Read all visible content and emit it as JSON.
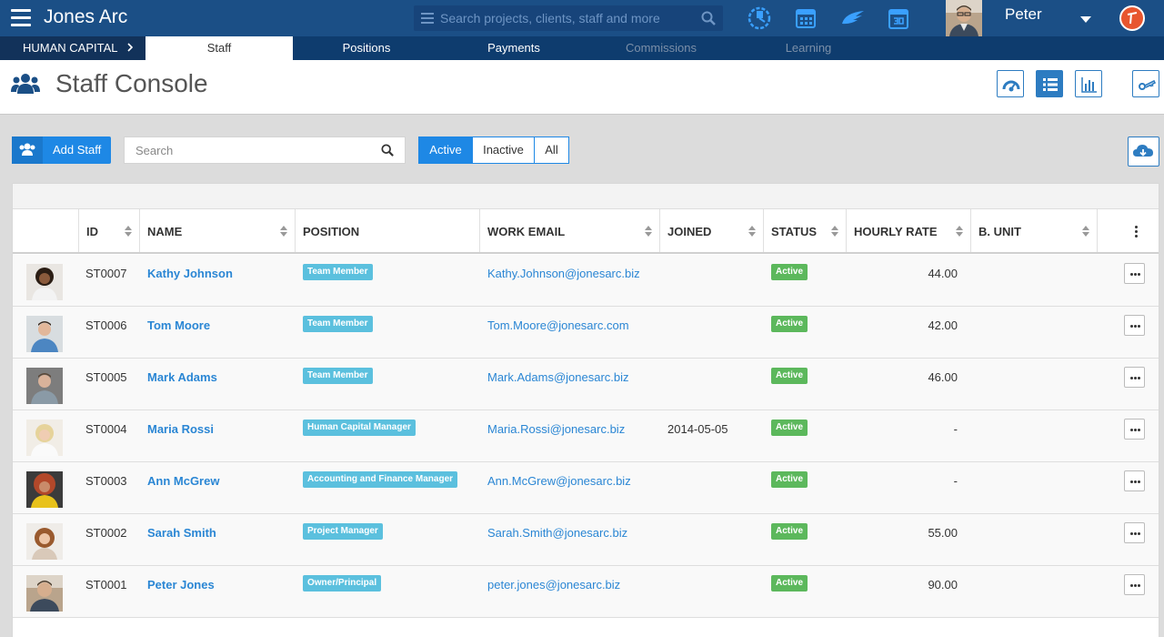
{
  "app": {
    "title": "Jones Arc"
  },
  "top_search": {
    "placeholder": "Search projects, clients, staff and more"
  },
  "user": {
    "name": "Peter"
  },
  "subnav": {
    "crumb": "HUMAN CAPITAL",
    "tabs": [
      {
        "label": "Staff",
        "state": "active"
      },
      {
        "label": "Positions",
        "state": "normal"
      },
      {
        "label": "Payments",
        "state": "normal"
      },
      {
        "label": "Commissions",
        "state": "disabled"
      },
      {
        "label": "Learning",
        "state": "disabled"
      }
    ]
  },
  "page": {
    "title": "Staff Console"
  },
  "toolbar": {
    "add_label": "Add Staff",
    "search_placeholder": "Search",
    "filters": [
      "Active",
      "Inactive",
      "All"
    ],
    "active_filter": "Active"
  },
  "table": {
    "columns": [
      "ID",
      "NAME",
      "POSITION",
      "WORK EMAIL",
      "JOINED",
      "STATUS",
      "HOURLY RATE",
      "B. UNIT"
    ],
    "rows": [
      {
        "id": "ST0007",
        "name": "Kathy Johnson",
        "position": "Team Member",
        "email": "Kathy.Johnson@jonesarc.biz",
        "joined": "",
        "status": "Active",
        "rate": "44.00",
        "bunit": ""
      },
      {
        "id": "ST0006",
        "name": "Tom Moore",
        "position": "Team Member",
        "email": "Tom.Moore@jonesarc.com",
        "joined": "",
        "status": "Active",
        "rate": "42.00",
        "bunit": ""
      },
      {
        "id": "ST0005",
        "name": "Mark Adams",
        "position": "Team Member",
        "email": "Mark.Adams@jonesarc.biz",
        "joined": "",
        "status": "Active",
        "rate": "46.00",
        "bunit": ""
      },
      {
        "id": "ST0004",
        "name": "Maria Rossi",
        "position": "Human Capital Manager",
        "email": "Maria.Rossi@jonesarc.biz",
        "joined": "2014-05-05",
        "status": "Active",
        "rate": "-",
        "bunit": ""
      },
      {
        "id": "ST0003",
        "name": "Ann McGrew",
        "position": "Accounting and Finance Manager",
        "email": "Ann.McGrew@jonesarc.biz",
        "joined": "",
        "status": "Active",
        "rate": "-",
        "bunit": ""
      },
      {
        "id": "ST0002",
        "name": "Sarah Smith",
        "position": "Project Manager",
        "email": "Sarah.Smith@jonesarc.biz",
        "joined": "",
        "status": "Active",
        "rate": "55.00",
        "bunit": ""
      },
      {
        "id": "ST0001",
        "name": "Peter Jones",
        "position": "Owner/Principal",
        "email": "peter.jones@jonesarc.biz",
        "joined": "",
        "status": "Active",
        "rate": "90.00",
        "bunit": ""
      }
    ]
  },
  "colors": {
    "topbar": "#1b4f86",
    "subnav": "#0e3c6e",
    "primary": "#1e88e5",
    "link": "#2a86d4",
    "badge_position": "#5bc0de",
    "badge_status": "#5cb85c"
  },
  "icons": [
    "menu-icon",
    "search-icon",
    "timer-icon",
    "calendar-icon",
    "wing-icon",
    "calendar-day-icon",
    "avatar",
    "brand-icon",
    "people-icon",
    "dashboard-icon",
    "list-icon",
    "bar-chart-icon",
    "key-icon",
    "cloud-download-icon",
    "kebab-icon"
  ]
}
